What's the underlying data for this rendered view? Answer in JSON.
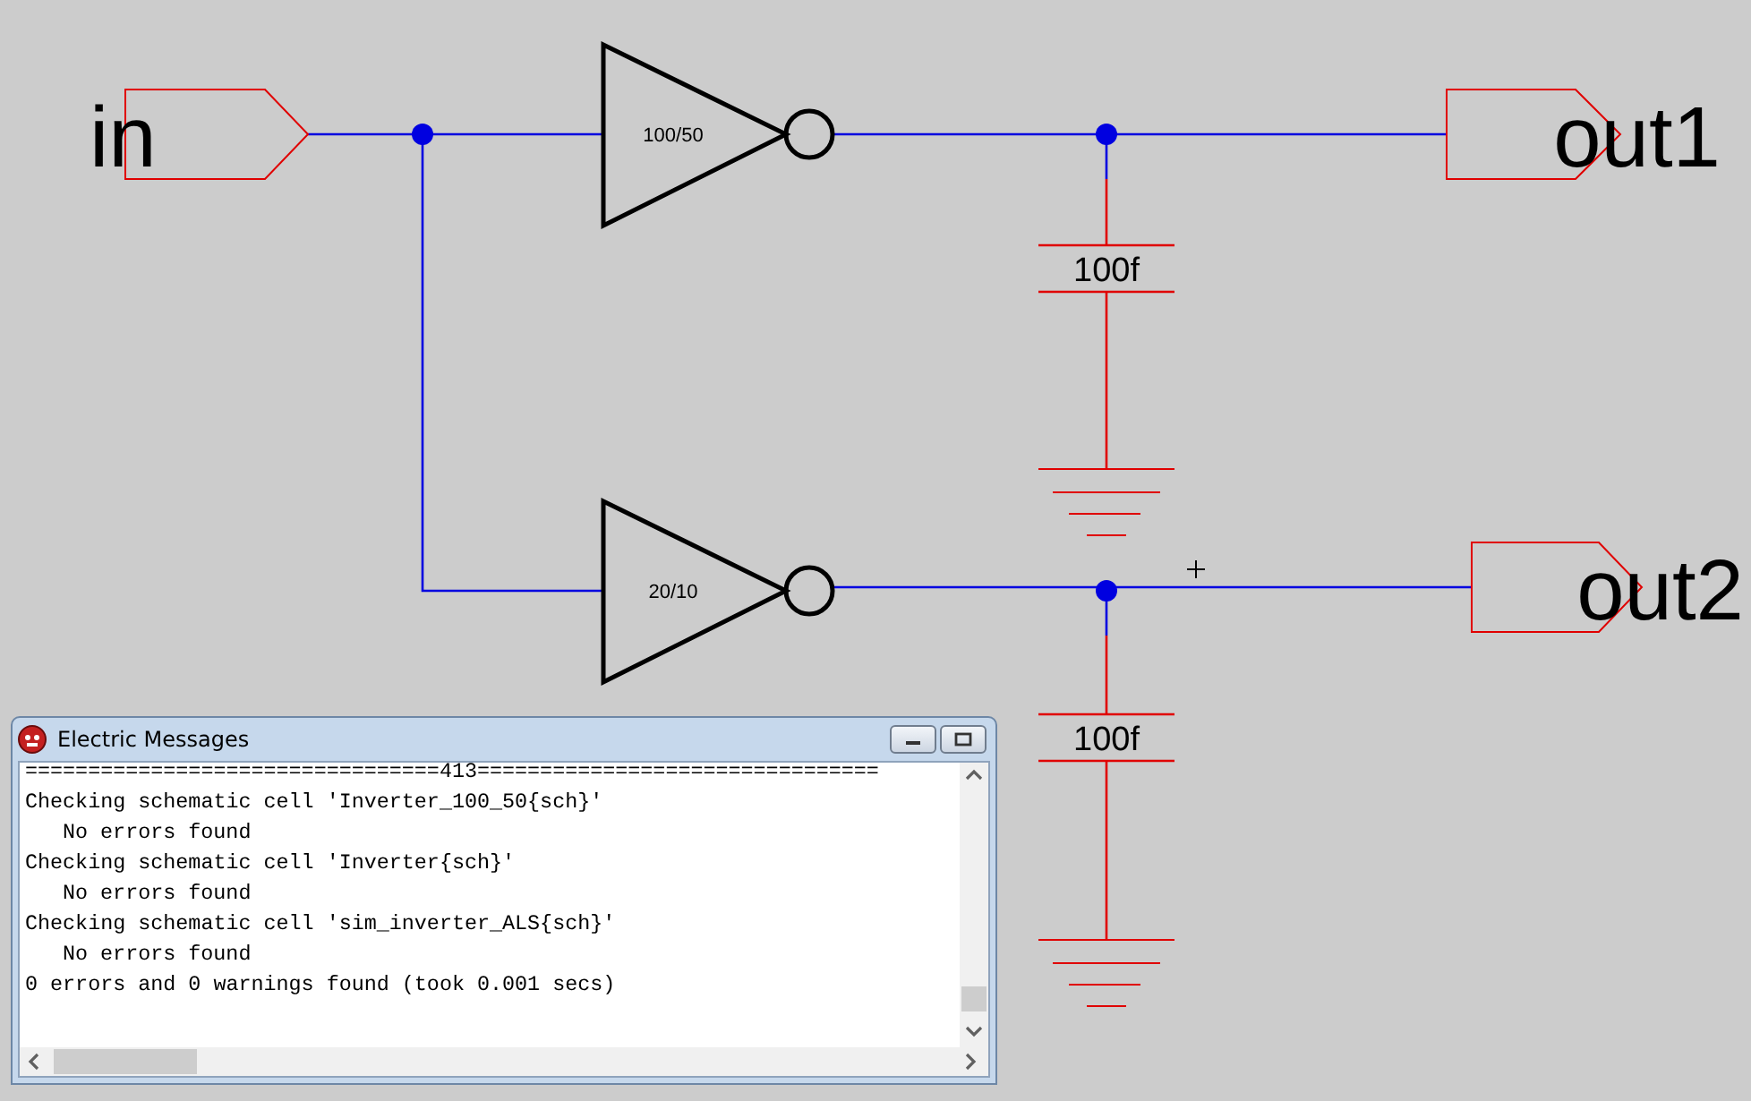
{
  "ports": [
    {
      "kind": "input",
      "label": "in"
    },
    {
      "kind": "output",
      "label": "out1"
    },
    {
      "kind": "output",
      "label": "out2"
    }
  ],
  "inverters": [
    {
      "label": "100/50"
    },
    {
      "label": "20/10"
    }
  ],
  "capacitors": [
    {
      "label": "100f"
    },
    {
      "label": "100f"
    }
  ],
  "messages_window": {
    "title": "Electric Messages",
    "lines": [
      {
        "kind": "plain",
        "text": "=================================413================================"
      },
      {
        "kind": "plain",
        "text": "Checking schematic cell 'Inverter_100_50{sch}'"
      },
      {
        "kind": "indented",
        "text": "No errors found"
      },
      {
        "kind": "plain",
        "text": "Checking schematic cell 'Inverter{sch}'"
      },
      {
        "kind": "indented",
        "text": "No errors found"
      },
      {
        "kind": "plain",
        "text": "Checking schematic cell 'sim_inverter_ALS{sch}'"
      },
      {
        "kind": "indented",
        "text": "No errors found"
      },
      {
        "kind": "plain",
        "text": "0 errors and 0 warnings found (took 0.001 secs)"
      }
    ]
  }
}
